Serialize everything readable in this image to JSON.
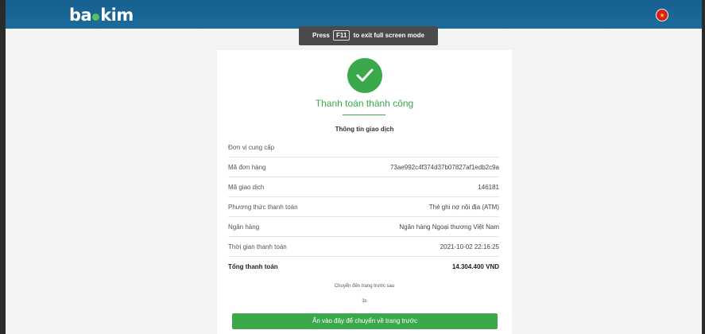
{
  "header": {
    "logo_text_left": "ba",
    "logo_text_right": "kim"
  },
  "fullscreen_notice": {
    "prefix": "Press",
    "key": "F11",
    "suffix": "to exit full screen mode"
  },
  "payment": {
    "status_title": "Thanh toán thành công",
    "section_title": "Thông tin giao dịch",
    "rows": [
      {
        "label": "Đơn vị cung cấp",
        "value": ""
      },
      {
        "label": "Mã đơn hàng",
        "value": "73ae992c4f374d37b07827af1edb2c9a"
      },
      {
        "label": "Mã giao dịch",
        "value": "146181"
      },
      {
        "label": "Phương thức thanh toán",
        "value": "Thẻ ghi nợ nội địa (ATM)"
      },
      {
        "label": "Ngân hàng",
        "value": "Ngân hàng Ngoại thương Việt Nam"
      },
      {
        "label": "Thời gian thanh toán",
        "value": "2021-10-02 22:16:25"
      },
      {
        "label": "Tổng thanh toán",
        "value": "14.304.400 VND"
      }
    ],
    "redirect_note": "Chuyển đến trang trước sau",
    "countdown": "3s",
    "back_button_label": "Ấn vào đây để chuyển về trang trước"
  },
  "colors": {
    "header_blue": "#1b6c9c",
    "success_green": "#3aa84b"
  }
}
